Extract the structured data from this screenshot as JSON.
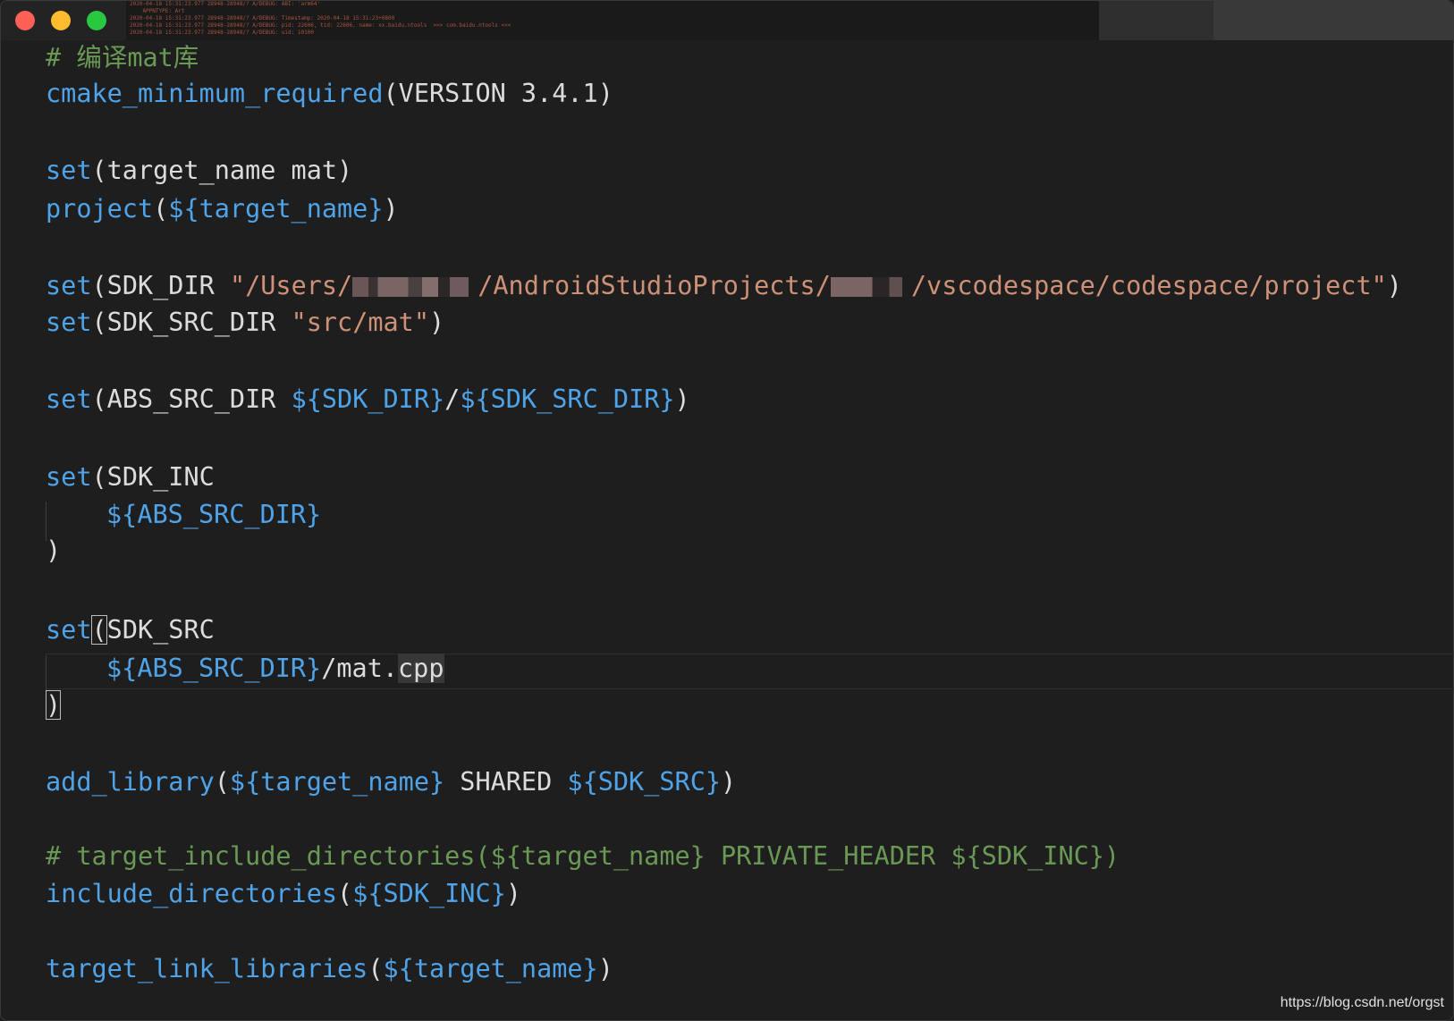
{
  "window": {
    "background_log_lines": [
      "2020-04-18 15:31:23.977 28948-28948/? A/DEBUG: ABI: 'arm64'",
      "    APPNTYPE: Art",
      "2020-04-18 15:31:23.977 28948-28948/? A/DEBUG: Timestamp: 2020-04-18 15:31:23+0800",
      "2020-04-18 15:31:23.977 28948-28948/? A/DEBUG: pid: 22606, tid: 22606, name: xx.baidu.ntools  >>> com.baidu.ntools <<<",
      "2020-04-18 15:31:23.977 28948-28948/? A/DEBUG: uid: 10100"
    ]
  },
  "code": {
    "comment_compile": "# 编译mat库",
    "cmake_fn": "cmake_minimum_required",
    "cmake_args": "(VERSION 3.4.1)",
    "set_kw": "set",
    "set_target_args": "(target_name mat)",
    "project_fn": "project",
    "paren_open": "(",
    "paren_close": ")",
    "target_name_var": "${target_name}",
    "sdk_dir_name": "SDK_DIR ",
    "str_users": "\"/Users/",
    "str_android_projects": "/AndroidStudioProjects/",
    "str_project_tail": "/vscodespace/codespace/project\"",
    "sdk_src_dir_name": "SDK_SRC_DIR ",
    "str_src_mat": "\"src/mat\"",
    "abs_src_dir_name": "ABS_SRC_DIR ",
    "sdk_dir_var": "${SDK_DIR}",
    "slash": "/",
    "sdk_src_dir_var": "${SDK_SRC_DIR}",
    "sdk_inc_name": "SDK_INC",
    "abs_src_dir_var": "${ABS_SRC_DIR}",
    "sdk_src_name": "SDK_SRC",
    "mat_file": "/mat.",
    "cpp_ext": "cpp",
    "add_library_fn": "add_library",
    "shared_kw": " SHARED ",
    "sdk_src_var": "${SDK_SRC}",
    "comment_target_include": "# target_include_directories(${target_name} PRIVATE_HEADER ${SDK_INC})",
    "include_dirs_fn": "include_directories",
    "sdk_inc_var": "${SDK_INC}",
    "target_link_fn": "target_link_libraries"
  },
  "watermark": "https://blog.csdn.net/orgst",
  "colors": {
    "background": "#1e1e1e",
    "keyword_function": "#4fa3e8",
    "string": "#ce9178",
    "comment": "#6a9955",
    "text": "#dcdcdc"
  }
}
